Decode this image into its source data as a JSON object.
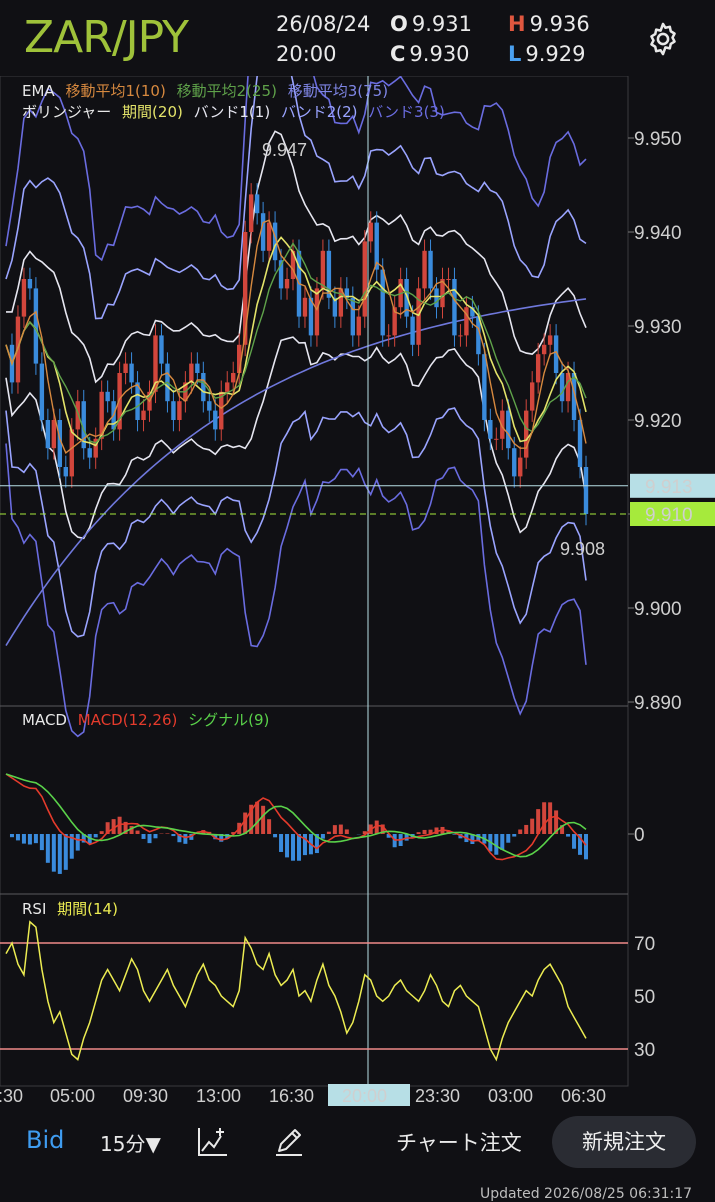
{
  "header": {
    "symbol": "ZAR/JPY",
    "date": "26/08/24",
    "time": "20:00",
    "open_key": "O",
    "open": "9.931",
    "high_key": "H",
    "high": "9.936",
    "close_key": "C",
    "close": "9.930",
    "low_key": "L",
    "low": "9.929",
    "settings_icon": "gear-icon"
  },
  "legend": {
    "ema_label": "EMA",
    "ema1": "移動平均1(10)",
    "ema2": "移動平均2(25)",
    "ema3": "移動平均3(75)",
    "bb_label": "ボリンジャー",
    "bb_period": "期間(20)",
    "bb_band1": "バンド1(1)",
    "bb_band2": "バンド2(2)",
    "bb_band3": "バンド3(3)",
    "macd_label": "MACD",
    "macd_params": "MACD(12,26)",
    "macd_signal": "シグナル(9)",
    "rsi_label": "RSI",
    "rsi_period": "期間(14)"
  },
  "colors": {
    "ema1": "#d7893f",
    "ema2": "#5fa24a",
    "ema3": "#6f78dc",
    "bb_mid": "#e3e36a",
    "bb1": "#e6e6f0",
    "bb2": "#9aa4ff",
    "bb3": "#6a6ce0",
    "up": "#d2463c",
    "down": "#3a8bdc",
    "macd": "#e53b2c",
    "signal": "#5ad24a",
    "rsi": "#ecec52",
    "rsi_level": "#f08a8a",
    "crosshair": "#b7dfe6",
    "price_tag": "#a6ea3c"
  },
  "price_axis": {
    "ticks": [
      "9.950",
      "9.940",
      "9.930",
      "9.920",
      "9.910",
      "9.900",
      "9.890"
    ]
  },
  "annotations": {
    "high_marker": "9.947",
    "low_marker": "9.908",
    "crosshair_price": "9.913",
    "current_price": "9.910"
  },
  "macd_axis": {
    "zero": "0"
  },
  "rsi_axis": {
    "ticks": [
      "70",
      "50",
      "30"
    ]
  },
  "time_axis": {
    "labels": [
      ":30",
      "05:00",
      "09:30",
      "13:00",
      "16:30",
      "20:00",
      "23:30",
      "03:00",
      "06:30"
    ],
    "highlighted": "20:00"
  },
  "chart_data": {
    "type": "candlestick",
    "symbol": "ZAR/JPY",
    "ylim": [
      9.885,
      9.955
    ],
    "bollinger": {
      "period": 20,
      "bands": [
        1,
        2,
        3
      ]
    },
    "ema_periods": [
      10,
      25,
      75
    ],
    "crosshair": {
      "time": "20:00",
      "price": 9.913
    },
    "markers": [
      {
        "label": "9.947",
        "value": 9.947
      },
      {
        "label": "9.908",
        "value": 9.908
      }
    ],
    "close_series": [
      9.928,
      9.924,
      9.931,
      9.935,
      9.934,
      9.926,
      9.92,
      9.917,
      9.92,
      9.915,
      9.914,
      9.919,
      9.922,
      9.917,
      9.916,
      9.918,
      9.923,
      9.922,
      9.919,
      9.925,
      9.926,
      9.924,
      9.92,
      9.921,
      9.923,
      9.929,
      9.926,
      9.922,
      9.92,
      9.922,
      9.924,
      9.926,
      9.925,
      9.922,
      9.921,
      9.919,
      9.923,
      9.924,
      9.925,
      9.928,
      9.94,
      9.944,
      9.942,
      9.938,
      9.941,
      9.937,
      9.934,
      9.935,
      9.938,
      9.931,
      9.933,
      9.929,
      9.934,
      9.938,
      9.933,
      9.931,
      9.934,
      9.933,
      9.929,
      9.931,
      9.939,
      9.941,
      9.936,
      9.929,
      9.929,
      9.932,
      9.935,
      9.931,
      9.928,
      9.934,
      9.938,
      9.934,
      9.932,
      9.935,
      9.935,
      9.929,
      9.929,
      9.932,
      9.931,
      9.927,
      9.92,
      9.918,
      9.918,
      9.921,
      9.917,
      9.914,
      9.916,
      9.921,
      9.924,
      9.927,
      9.928,
      9.929,
      9.925,
      9.922,
      9.925,
      9.92,
      9.915,
      9.91
    ],
    "macd": {
      "zero_level": 0,
      "params": [
        12,
        26
      ],
      "signal": 9
    },
    "rsi": {
      "period": 14,
      "levels": [
        70,
        30
      ],
      "values": [
        66,
        70,
        62,
        58,
        78,
        76,
        60,
        48,
        40,
        44,
        36,
        28,
        26,
        34,
        40,
        48,
        56,
        60,
        56,
        52,
        58,
        64,
        60,
        52,
        48,
        52,
        56,
        60,
        54,
        50,
        46,
        52,
        58,
        62,
        56,
        54,
        50,
        48,
        46,
        52,
        72,
        68,
        62,
        60,
        66,
        58,
        54,
        56,
        60,
        50,
        52,
        48,
        56,
        62,
        54,
        50,
        44,
        36,
        40,
        48,
        58,
        56,
        50,
        48,
        50,
        54,
        56,
        52,
        50,
        48,
        52,
        58,
        54,
        48,
        46,
        52,
        54,
        50,
        48,
        46,
        38,
        30,
        26,
        34,
        40,
        44,
        48,
        52,
        50,
        56,
        60,
        62,
        58,
        54,
        46,
        42,
        38,
        34
      ]
    }
  },
  "toolbar": {
    "bid": "Bid",
    "period": "15分▼",
    "chart_order": "チャート注文",
    "new_order": "新規注文"
  },
  "footer": {
    "updated": "Updated 2026/08/25 06:31:17"
  }
}
